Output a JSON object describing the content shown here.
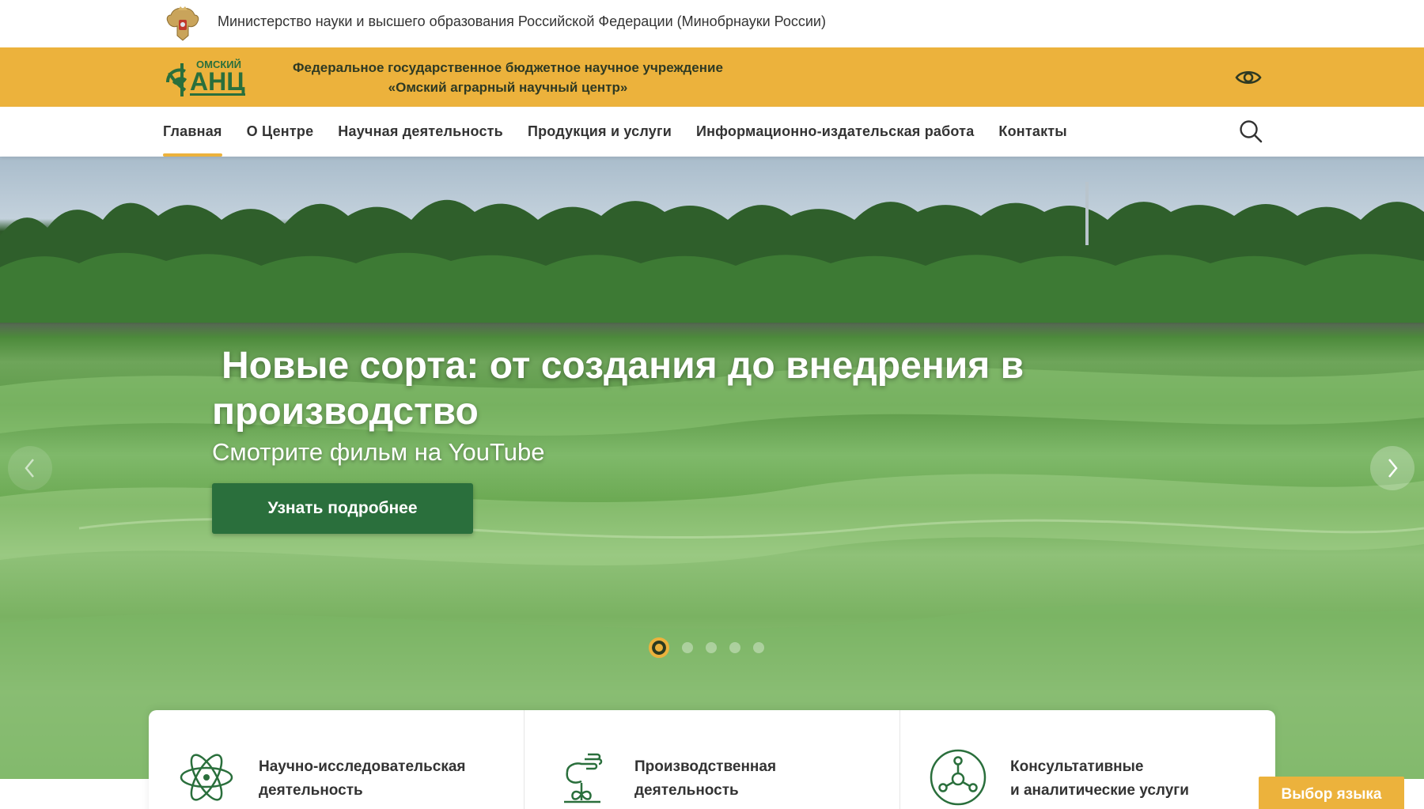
{
  "ministry": {
    "name": "Министерство науки и высшего образования Российской Федерации (Минобрнауки России)"
  },
  "institution": {
    "logo_top": "ОМСКИЙ",
    "logo_main": "АНЦ",
    "title_line1": "Федеральное государственное бюджетное научное учреждение",
    "title_line2": "«Омский аграрный научный центр»"
  },
  "nav": {
    "items": [
      {
        "label": "Главная",
        "active": true
      },
      {
        "label": "О Центре"
      },
      {
        "label": "Научная деятельность"
      },
      {
        "label": "Продукция и услуги"
      },
      {
        "label": "Информационно-издательская работа"
      },
      {
        "label": "Контакты"
      }
    ]
  },
  "hero": {
    "title_line1": "Новые сорта: от создания до внедрения в",
    "title_line2": "производство",
    "subtitle": "Смотрите фильм на YouTube",
    "button_label": "Узнать подробнее",
    "slides_total": 5,
    "active_slide": 1
  },
  "services": [
    {
      "label": "Научно-исследовательская\nдеятельность",
      "icon": "atom-icon"
    },
    {
      "label": "Производственная\nдеятельность",
      "icon": "hand-sprout-icon"
    },
    {
      "label": "Консультативные\nи аналитические услуги",
      "icon": "network-icon"
    }
  ],
  "language": {
    "label": "Выбор языка"
  },
  "colors": {
    "accent": "#ecb23c",
    "primary_green": "#2a6f3c",
    "text_dark": "#333333"
  }
}
